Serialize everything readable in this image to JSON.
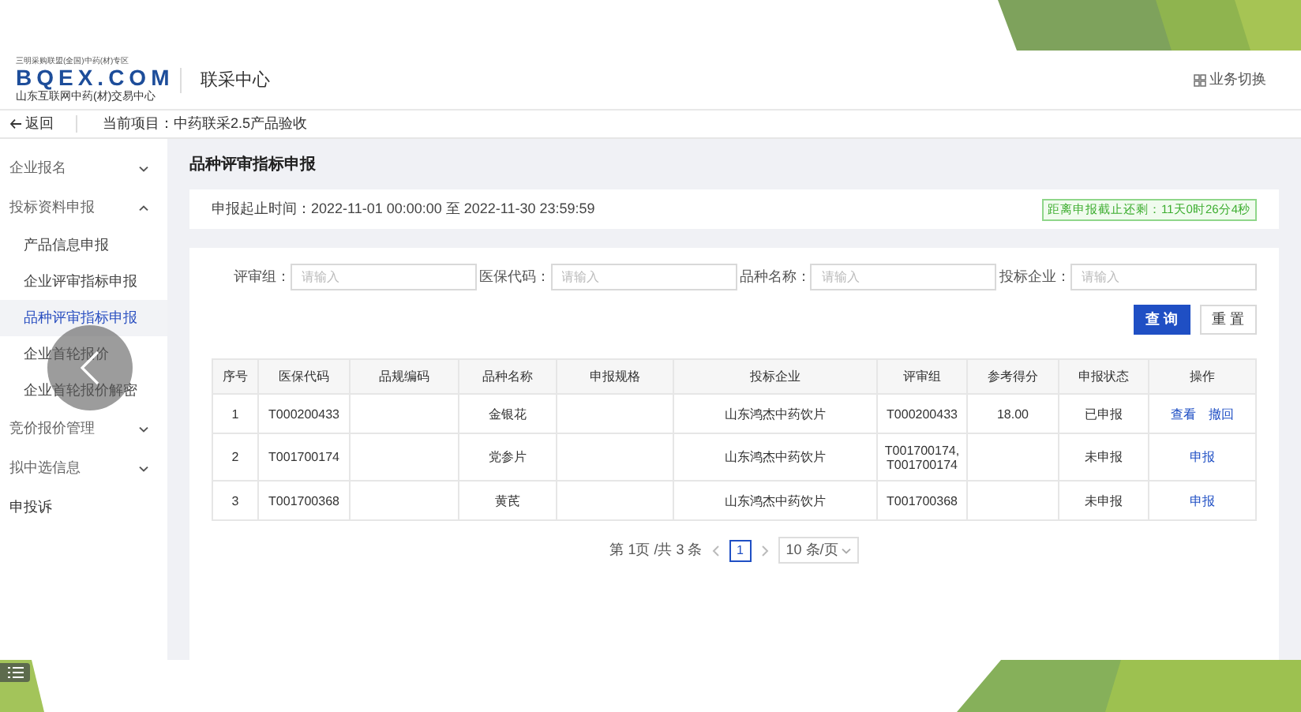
{
  "header": {
    "logo": {
      "tagline": "三明采购联盟(全国)中药(材)专区",
      "brand": "BQEX.COM",
      "subtitle": "山东互联网中药(材)交易中心"
    },
    "title": "联采中心",
    "switch_link": "业务切换"
  },
  "breadcrumb": {
    "back": "返回",
    "current_project": "当前项目：中药联采2.5产品验收"
  },
  "sidebar": {
    "items": [
      {
        "label": "企业报名",
        "kind": "group",
        "expanded": false
      },
      {
        "label": "投标资料申报",
        "kind": "group",
        "expanded": true,
        "children": [
          {
            "label": "产品信息申报",
            "selected": false
          },
          {
            "label": "企业评审指标申报",
            "selected": false
          },
          {
            "label": "品种评审指标申报",
            "selected": true
          },
          {
            "label": "企业首轮报价",
            "selected": false
          },
          {
            "label": "企业首轮报价解密",
            "selected": false
          }
        ]
      },
      {
        "label": "竞价报价管理",
        "kind": "group",
        "expanded": false
      },
      {
        "label": "拟中选信息",
        "kind": "group",
        "expanded": false
      },
      {
        "label": "申投诉",
        "kind": "link"
      }
    ]
  },
  "page_title": "品种评审指标申报",
  "period": "申报起止时间：2022-11-01 00:00:00 至 2022-11-30 23:59:59",
  "countdown": "距离申报截止还剩：11天0时26分4秒",
  "filters": [
    {
      "label": "评审组：",
      "placeholder": "请输入"
    },
    {
      "label": "医保代码：",
      "placeholder": "请输入"
    },
    {
      "label": "品种名称：",
      "placeholder": "请输入"
    },
    {
      "label": "投标企业：",
      "placeholder": "请输入"
    }
  ],
  "buttons": [
    {
      "label": "查 询",
      "kind": "primary"
    },
    {
      "label": "重 置",
      "kind": "default"
    }
  ],
  "table": {
    "columns": [
      "序号",
      "医保代码",
      "品规编码",
      "品种名称",
      "申报规格",
      "投标企业",
      "评审组",
      "参考得分",
      "申报状态",
      "操作"
    ],
    "rows": [
      {
        "cells": [
          "1",
          "T000200433",
          "",
          "金银花",
          "",
          "山东鸿杰中药饮片",
          "T000200433",
          "18.00",
          "已申报"
        ],
        "actions": [
          "查看",
          "撤回"
        ]
      },
      {
        "cells": [
          "2",
          "T001700174",
          "",
          "党参片",
          "",
          "山东鸿杰中药饮片",
          "T001700174, T001700174",
          "",
          "未申报"
        ],
        "actions": [
          "申报"
        ]
      },
      {
        "cells": [
          "3",
          "T001700368",
          "",
          "黄芪",
          "",
          "山东鸿杰中药饮片",
          "T001700368",
          "",
          "未申报"
        ],
        "actions": [
          "申报"
        ]
      }
    ]
  },
  "pagination": {
    "summary": "第 1页 /共 3 条",
    "pages": [
      {
        "label": "1",
        "selected": true
      }
    ],
    "page_size": "10 条/页"
  }
}
